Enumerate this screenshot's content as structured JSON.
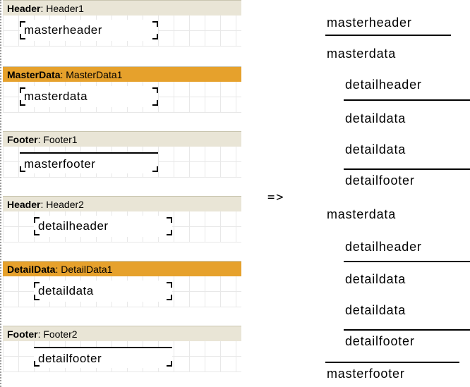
{
  "designer": {
    "bands": [
      {
        "type": "Header",
        "name": "Header1",
        "kind": "plain",
        "field": "masterheader"
      },
      {
        "type": "MasterData",
        "name": "MasterData1",
        "kind": "data",
        "field": "masterdata"
      },
      {
        "type": "Footer",
        "name": "Footer1",
        "kind": "plain",
        "field": "masterfooter"
      },
      {
        "type": "Header",
        "name": "Header2",
        "kind": "plain",
        "field": "detailheader"
      },
      {
        "type": "DetailData",
        "name": "DetailData1",
        "kind": "data",
        "field": "detaildata"
      },
      {
        "type": "Footer",
        "name": "Footer2",
        "kind": "plain",
        "field": "detailfooter"
      }
    ],
    "colors": {
      "plain_band": "#e9e5d6",
      "data_band": "#e6a12c"
    }
  },
  "arrow": "=>",
  "preview": {
    "rows": [
      "masterheader",
      "masterdata",
      "detailheader",
      "detaildata",
      "detaildata",
      "detailfooter",
      "masterdata",
      "detailheader",
      "detaildata",
      "detaildata",
      "detailfooter",
      "masterfooter"
    ]
  }
}
